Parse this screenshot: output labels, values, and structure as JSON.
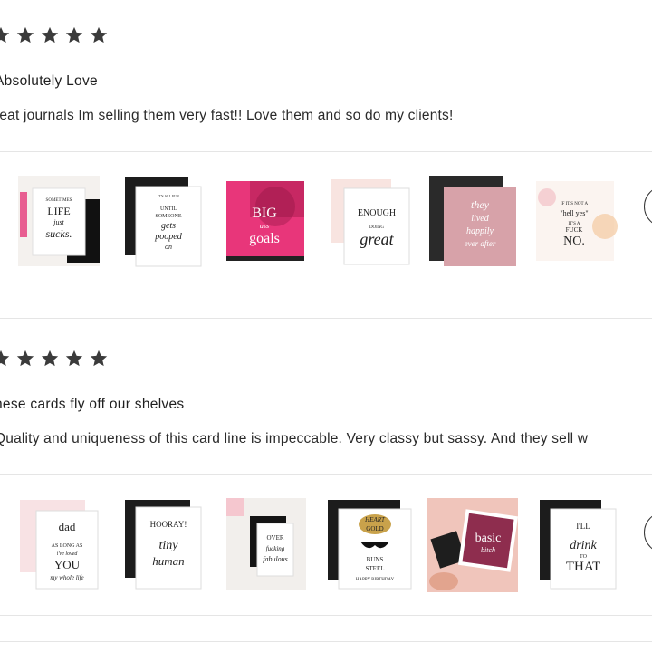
{
  "reviews": [
    {
      "rating": 5,
      "title": "Absolutely Love",
      "body": "reat journals Im selling them very fast!! Love them and so do my clients!",
      "products": [
        {
          "name": "life-sucks-card",
          "lines": [
            "SOMETIMES",
            "LIFE",
            "just",
            "sucks."
          ]
        },
        {
          "name": "until-someone-card",
          "lines": [
            "IT'S ALL FUN",
            "UNTIL",
            "SOMEONE",
            "gets",
            "pooped",
            "on"
          ]
        },
        {
          "name": "big-goals-journal",
          "lines": [
            "BIG",
            "ass",
            "goals"
          ]
        },
        {
          "name": "enough-doing-great-card",
          "lines": [
            "ENOUGH",
            "DOING",
            "great"
          ]
        },
        {
          "name": "happily-ever-after-card",
          "lines": [
            "they",
            "lived",
            "happily",
            "ever after"
          ]
        },
        {
          "name": "hell-yes-card",
          "lines": [
            "IF IT'S NOT A",
            "\"hell yes\"",
            "IT'S A",
            "FUCK",
            "NO."
          ]
        }
      ]
    },
    {
      "rating": 5,
      "title": "hese cards fly off our shelves",
      "body": "Quality and uniqueness of this card line is impeccable. Very classy but sassy. And they sell w",
      "products": [
        {
          "name": "dad-card",
          "lines": [
            "dad",
            "AS LONG AS",
            "i've loved",
            "YOU",
            "my whole life"
          ]
        },
        {
          "name": "hooray-tiny-human-card",
          "lines": [
            "HOORAY!",
            "tiny",
            "human"
          ]
        },
        {
          "name": "over-fabulous-card",
          "lines": [
            "OVER",
            "fucking",
            "fabulous"
          ]
        },
        {
          "name": "heart-gold-buns-steel-card",
          "lines": [
            "HEART",
            "GOLD",
            "BUNS",
            "STEEL",
            "HAPPY BIRTHDAY"
          ]
        },
        {
          "name": "basic-bitch-card",
          "lines": [
            "basic",
            "bitch"
          ]
        },
        {
          "name": "ill-drink-to-that-card",
          "lines": [
            "I'LL",
            "drink",
            "TO",
            "THAT"
          ]
        }
      ]
    }
  ],
  "colors": {
    "star": "#3b3b3b",
    "divider": "#e5e5e5",
    "pink_journal": "#e8367a"
  },
  "icons": {
    "star": "star-icon",
    "next": "chevron-right-icon"
  }
}
